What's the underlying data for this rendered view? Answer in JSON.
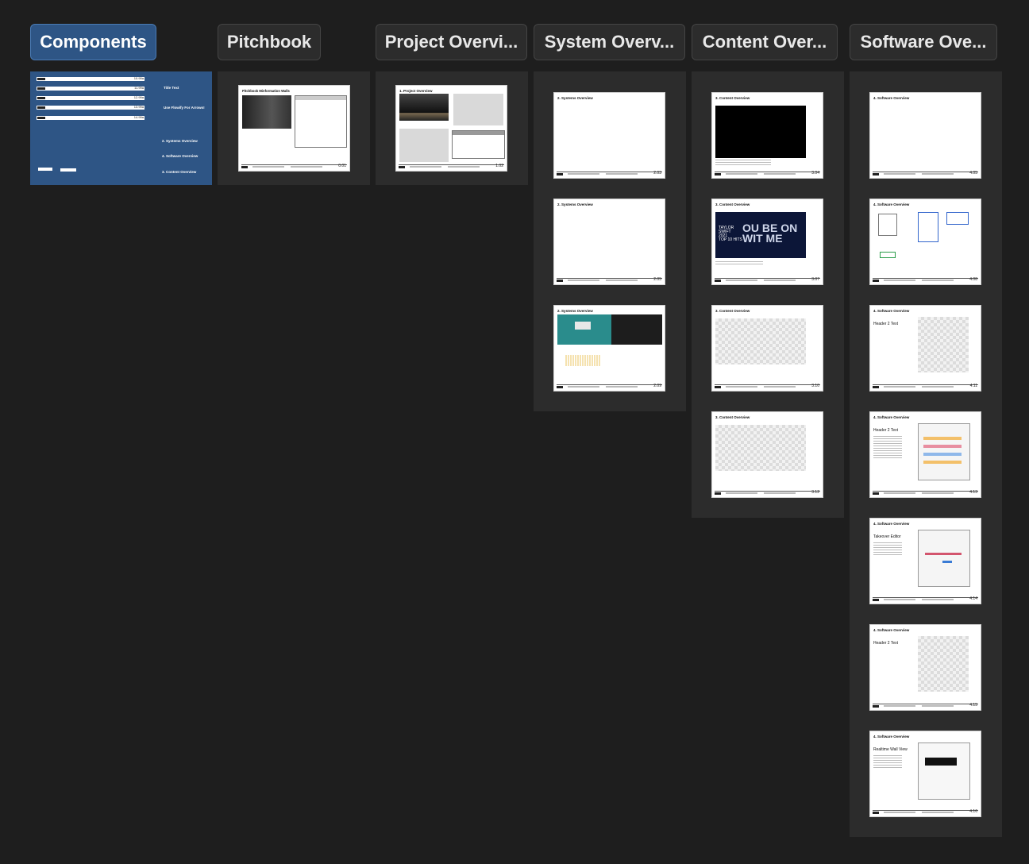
{
  "tabs": [
    {
      "label": "Components",
      "active": true
    },
    {
      "label": "Pitchbook"
    },
    {
      "label": "Project Overvi..."
    },
    {
      "label": "System Overv..."
    },
    {
      "label": "Content Over..."
    },
    {
      "label": "Software Ove..."
    }
  ],
  "components": {
    "row_numbers": [
      "10.99a",
      "11.99a",
      "12.99a",
      "13.99a",
      "14.99a"
    ],
    "title_text": "Title Text",
    "arrows_text": "Use Flowify For Arrows!",
    "links": [
      "2. Systems  Overview",
      "4. Software Overview",
      "3. Content Overview"
    ]
  },
  "pitchbook": {
    "title": "Pitchbook Minformation Walls",
    "page": "0.01"
  },
  "project": {
    "title": "1. Project Overview",
    "page": "1.02"
  },
  "systems": {
    "pages": [
      {
        "title": "2. Systems  Overview",
        "page": "2.03"
      },
      {
        "title": "2. Systems  Overview",
        "page": "2.05"
      },
      {
        "title": "2. Systems  Overview",
        "page": "2.09"
      }
    ]
  },
  "content": {
    "pages": [
      {
        "title": "3. Content Overview",
        "page": "3.04"
      },
      {
        "title": "3. Content Overview",
        "page": "3.07"
      },
      {
        "title": "3. Content Overview",
        "page": "3.10"
      },
      {
        "title": "3. Content Overview",
        "page": "3.12"
      }
    ],
    "poster_text": [
      "TAYLOR",
      "SWIFT",
      "2021",
      "TOP 10 HITS"
    ],
    "poster_big": "OU BE ON WIT ME"
  },
  "software": {
    "pages": [
      {
        "title": "4. Software Overview",
        "page": "4.05"
      },
      {
        "title": "4. Software Overview",
        "page": "4.08"
      },
      {
        "title": "4. Software Overview",
        "page": "4.11",
        "header": "Header 2 Text"
      },
      {
        "title": "4. Software Overview",
        "page": "4.13",
        "header": "Header 2 Text"
      },
      {
        "title": "4. Software Overview",
        "page": "4.14",
        "header": "Takeover Editor"
      },
      {
        "title": "4. Software Overview",
        "page": "4.15",
        "header": "Header 2 Text"
      },
      {
        "title": "4. Software Overview",
        "page": "4.16",
        "header": "Realtime Wall View"
      }
    ]
  },
  "colors": {
    "background": "#1e1e1e",
    "section": "#2c2c2c",
    "active": "#2e5585",
    "accent_red": "#e05050"
  }
}
